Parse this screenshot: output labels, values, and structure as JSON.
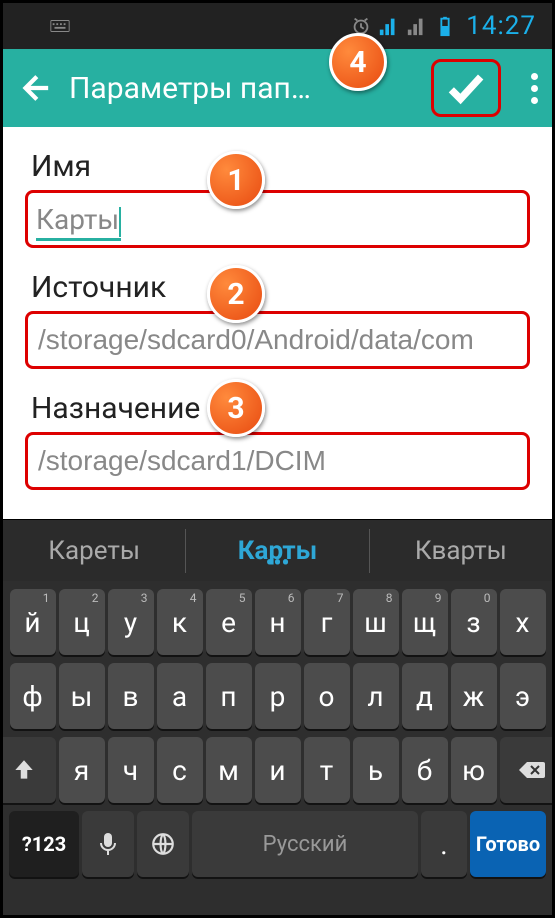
{
  "statusbar": {
    "time": "14:27"
  },
  "actionbar": {
    "title": "Параметры пап…"
  },
  "form": {
    "name": {
      "label": "Имя",
      "value": "Карты"
    },
    "source": {
      "label": "Источник",
      "value": "/storage/sdcard0/Android/data/com"
    },
    "dest": {
      "label": "Назначение",
      "value": "/storage/sdcard1/DCIM"
    }
  },
  "annotations": {
    "a1": "1",
    "a2": "2",
    "a3": "3",
    "a4": "4"
  },
  "suggestions": {
    "s1": "Кареты",
    "s2": "Карты",
    "s3": "Кварты"
  },
  "keyboard": {
    "row1": [
      {
        "k": "й",
        "s": "1"
      },
      {
        "k": "ц",
        "s": "2"
      },
      {
        "k": "у",
        "s": "3"
      },
      {
        "k": "к",
        "s": "4"
      },
      {
        "k": "е",
        "s": "5"
      },
      {
        "k": "н",
        "s": "6"
      },
      {
        "k": "г",
        "s": "7"
      },
      {
        "k": "ш",
        "s": "8"
      },
      {
        "k": "щ",
        "s": "9"
      },
      {
        "k": "з",
        "s": "0"
      },
      {
        "k": "х",
        "s": ""
      }
    ],
    "row2": [
      {
        "k": "ф"
      },
      {
        "k": "ы"
      },
      {
        "k": "в"
      },
      {
        "k": "а"
      },
      {
        "k": "п"
      },
      {
        "k": "р"
      },
      {
        "k": "о"
      },
      {
        "k": "л"
      },
      {
        "k": "д"
      },
      {
        "k": "ж"
      },
      {
        "k": "э"
      }
    ],
    "row3": [
      {
        "k": "я"
      },
      {
        "k": "ч"
      },
      {
        "k": "с"
      },
      {
        "k": "м"
      },
      {
        "k": "и"
      },
      {
        "k": "т"
      },
      {
        "k": "ь"
      },
      {
        "k": "б"
      },
      {
        "k": "ю"
      }
    ],
    "row4": {
      "sym": "?123",
      "space": "Русский",
      "dot": ".",
      "go": "Готово"
    }
  }
}
